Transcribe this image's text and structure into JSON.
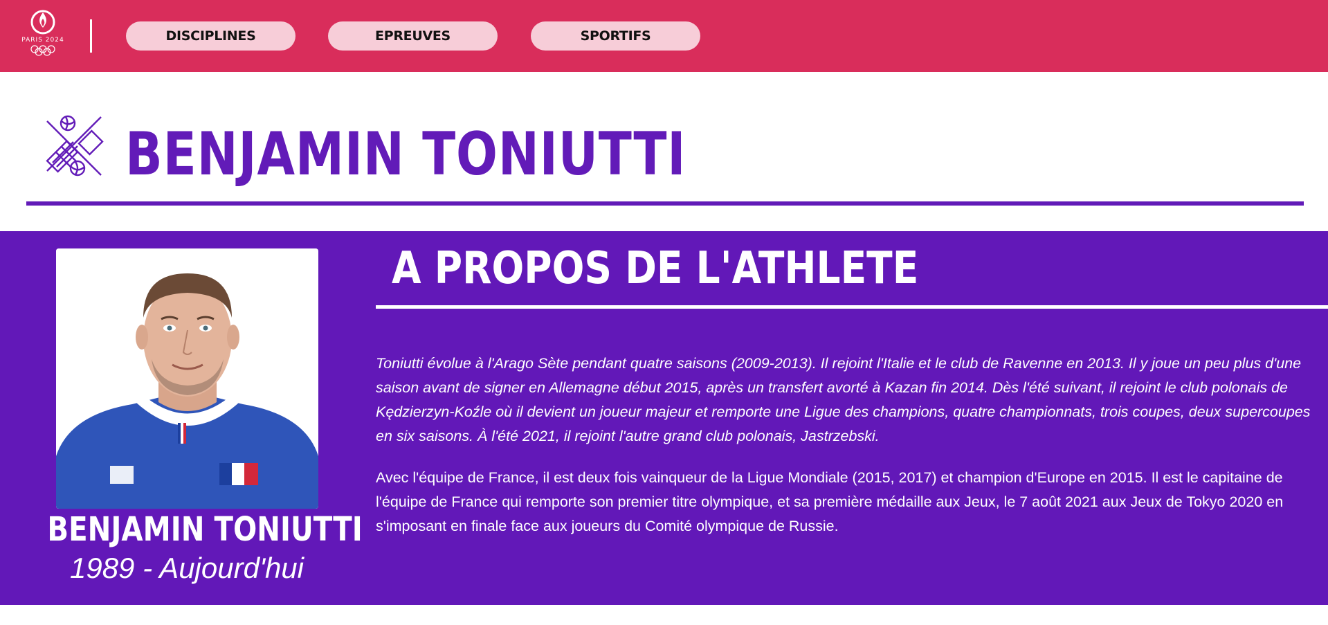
{
  "header": {
    "logo": {
      "text": "PARIS 2024",
      "icon": "olympic-flame-icon"
    },
    "nav": [
      {
        "label": "DISCIPLINES"
      },
      {
        "label": "EPREUVES"
      },
      {
        "label": "SPORTIFS"
      }
    ]
  },
  "athlete": {
    "title": "BENJAMIN TONIUTTI",
    "sport_icon": "volleyball-icon",
    "card_name": "BENJAMIN TONIUTTI",
    "card_years": "1989 - Aujourd'hui",
    "photo_icon": "athlete-photo"
  },
  "about": {
    "heading": "A PROPOS DE L'ATHLETE",
    "paragraph_1": "Toniutti évolue à l'Arago Sète pendant quatre saisons (2009-2013). Il rejoint l'Italie et le club de Ravenne en 2013. Il y joue un peu plus d'une saison avant de signer en Allemagne début 2015, après un transfert avorté à Kazan fin 2014. Dès l'été suivant, il rejoint le club polonais de Kędzierzyn-Koźle où il devient un joueur majeur et remporte une Ligue des champions, quatre championnats, trois coupes, deux supercoupes en six saisons. À l'été 2021, il rejoint l'autre grand club polonais, Jastrzebski.",
    "paragraph_2": "Avec l'équipe de France, il est deux fois vainqueur de la Ligue Mondiale (2015, 2017) et champion d'Europe en 2015. Il est le capitaine de l'équipe de France qui remporte son premier titre olympique, et sa première médaille aux Jeux, le 7 août 2021 aux Jeux de Tokyo 2020 en s'imposant en finale face aux joueurs du Comité olympique de Russie."
  },
  "colors": {
    "header_bg": "#d92d5b",
    "nav_pill_bg": "#f7cdd8",
    "brand_purple": "#621bb8",
    "text_light": "#ffffff"
  }
}
